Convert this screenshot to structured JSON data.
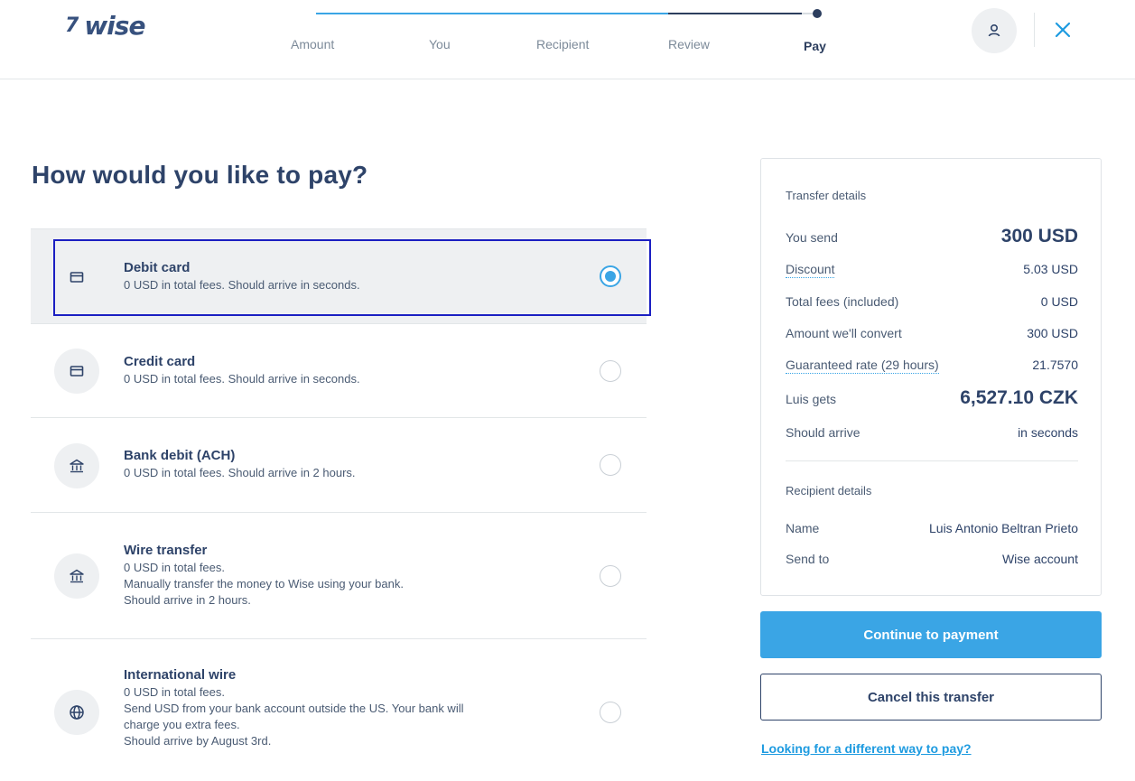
{
  "header": {
    "logo_flag": "7",
    "logo_text": "wise",
    "steps": [
      "Amount",
      "You",
      "Recipient",
      "Review",
      "Pay"
    ],
    "active_step": "Pay",
    "profile_icon": "user-icon",
    "close_icon": "close-icon"
  },
  "main": {
    "title": "How would you like to pay?",
    "options": [
      {
        "title": "Debit card",
        "desc": [
          "0 USD in total fees. Should arrive in seconds."
        ],
        "icon": "card-icon",
        "selected": true
      },
      {
        "title": "Credit card",
        "desc": [
          "0 USD in total fees. Should arrive in seconds."
        ],
        "icon": "card-icon",
        "selected": false
      },
      {
        "title": "Bank debit (ACH)",
        "desc": [
          "0 USD in total fees. Should arrive in 2 hours."
        ],
        "icon": "bank-icon",
        "selected": false
      },
      {
        "title": "Wire transfer",
        "desc": [
          "0 USD in total fees.",
          "Manually transfer the money to Wise using your bank.",
          "Should arrive in 2 hours."
        ],
        "icon": "bank-icon",
        "selected": false
      },
      {
        "title": "International wire",
        "desc": [
          "0 USD in total fees.",
          "Send USD from your bank account outside the US. Your bank will",
          "charge you extra fees.",
          "Should arrive by August 3rd."
        ],
        "icon": "globe-icon",
        "selected": false
      }
    ]
  },
  "transfer": {
    "title": "Transfer details",
    "rows": [
      {
        "label": "You send",
        "value": "300 USD"
      },
      {
        "label": "Discount",
        "value": "5.03 USD"
      },
      {
        "label": "Total fees (included)",
        "value": "0 USD"
      },
      {
        "label": "Amount we'll convert",
        "value": "300 USD"
      },
      {
        "label": "Guaranteed rate (29 hours)",
        "value": "21.7570"
      },
      {
        "label": "Luis gets",
        "value": "6,527.10 CZK"
      },
      {
        "label": "Should arrive",
        "value": "in seconds"
      }
    ]
  },
  "recipient": {
    "title": "Recipient details",
    "rows": [
      {
        "label": "Name",
        "value": "Luis Antonio Beltran Prieto"
      },
      {
        "label": "Send to",
        "value": "Wise account"
      }
    ]
  },
  "actions": {
    "continue_label": "Continue to payment",
    "cancel_label": "Cancel this transfer",
    "alt_link": "Looking for a different way to pay?"
  },
  "colors": {
    "accent": "#3aa5e5",
    "navy": "#2e4369",
    "focus": "#1b1fc2"
  }
}
